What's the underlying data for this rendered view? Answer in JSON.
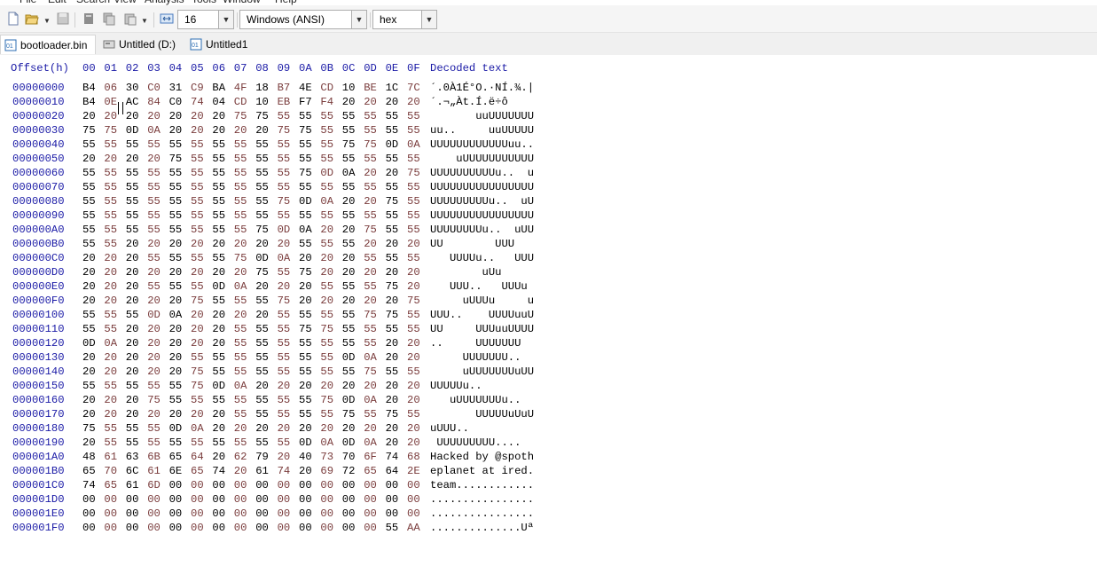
{
  "menu": [
    "File",
    "Edit",
    "Search",
    "View",
    "Analysis",
    "Tools",
    "Window",
    "Help"
  ],
  "toolbar": {
    "bytes_per_row": "16",
    "encoding": "Windows (ANSI)",
    "view_mode": "hex"
  },
  "tabs": [
    {
      "label": "bootloader.bin",
      "active": true
    },
    {
      "label": "Untitled (D:)",
      "active": false
    },
    {
      "label": "Untitled1",
      "active": false
    }
  ],
  "header": {
    "offset": "Offset(h)",
    "columns": [
      "00",
      "01",
      "02",
      "03",
      "04",
      "05",
      "06",
      "07",
      "08",
      "09",
      "0A",
      "0B",
      "0C",
      "0D",
      "0E",
      "0F"
    ],
    "decoded": "Decoded text"
  },
  "rows": [
    {
      "offset": "00000000",
      "bytes": [
        "B4",
        "06",
        "30",
        "C0",
        "31",
        "C9",
        "BA",
        "4F",
        "18",
        "B7",
        "4E",
        "CD",
        "10",
        "BE",
        "1C",
        "7C"
      ],
      "text": "´.0À1É°O.·NÍ.¾.|"
    },
    {
      "offset": "00000010",
      "bytes": [
        "B4",
        "0E",
        "AC",
        "84",
        "C0",
        "74",
        "04",
        "CD",
        "10",
        "EB",
        "F7",
        "F4",
        "20",
        "20",
        "20",
        "20"
      ],
      "text": "´.¬„Àt.Í.ë÷ô    "
    },
    {
      "offset": "00000020",
      "bytes": [
        "20",
        "20",
        "20",
        "20",
        "20",
        "20",
        "20",
        "75",
        "75",
        "55",
        "55",
        "55",
        "55",
        "55",
        "55",
        "55"
      ],
      "text": "       uuUUUUUUU"
    },
    {
      "offset": "00000030",
      "bytes": [
        "75",
        "75",
        "0D",
        "0A",
        "20",
        "20",
        "20",
        "20",
        "20",
        "75",
        "75",
        "55",
        "55",
        "55",
        "55",
        "55"
      ],
      "text": "uu..     uuUUUUU"
    },
    {
      "offset": "00000040",
      "bytes": [
        "55",
        "55",
        "55",
        "55",
        "55",
        "55",
        "55",
        "55",
        "55",
        "55",
        "55",
        "55",
        "75",
        "75",
        "0D",
        "0A"
      ],
      "text": "UUUUUUUUUUUUuu.."
    },
    {
      "offset": "00000050",
      "bytes": [
        "20",
        "20",
        "20",
        "20",
        "75",
        "55",
        "55",
        "55",
        "55",
        "55",
        "55",
        "55",
        "55",
        "55",
        "55",
        "55"
      ],
      "text": "    uUUUUUUUUUUU"
    },
    {
      "offset": "00000060",
      "bytes": [
        "55",
        "55",
        "55",
        "55",
        "55",
        "55",
        "55",
        "55",
        "55",
        "55",
        "75",
        "0D",
        "0A",
        "20",
        "20",
        "75"
      ],
      "text": "UUUUUUUUUUu..  u"
    },
    {
      "offset": "00000070",
      "bytes": [
        "55",
        "55",
        "55",
        "55",
        "55",
        "55",
        "55",
        "55",
        "55",
        "55",
        "55",
        "55",
        "55",
        "55",
        "55",
        "55"
      ],
      "text": "UUUUUUUUUUUUUUUU"
    },
    {
      "offset": "00000080",
      "bytes": [
        "55",
        "55",
        "55",
        "55",
        "55",
        "55",
        "55",
        "55",
        "55",
        "75",
        "0D",
        "0A",
        "20",
        "20",
        "75",
        "55"
      ],
      "text": "UUUUUUUUUu..  uU"
    },
    {
      "offset": "00000090",
      "bytes": [
        "55",
        "55",
        "55",
        "55",
        "55",
        "55",
        "55",
        "55",
        "55",
        "55",
        "55",
        "55",
        "55",
        "55",
        "55",
        "55"
      ],
      "text": "UUUUUUUUUUUUUUUU"
    },
    {
      "offset": "000000A0",
      "bytes": [
        "55",
        "55",
        "55",
        "55",
        "55",
        "55",
        "55",
        "55",
        "75",
        "0D",
        "0A",
        "20",
        "20",
        "75",
        "55",
        "55"
      ],
      "text": "UUUUUUUUu..  uUU"
    },
    {
      "offset": "000000B0",
      "bytes": [
        "55",
        "55",
        "20",
        "20",
        "20",
        "20",
        "20",
        "20",
        "20",
        "20",
        "55",
        "55",
        "55",
        "20",
        "20",
        "20"
      ],
      "text": "UU        UUU   "
    },
    {
      "offset": "000000C0",
      "bytes": [
        "20",
        "20",
        "20",
        "55",
        "55",
        "55",
        "55",
        "75",
        "0D",
        "0A",
        "20",
        "20",
        "20",
        "55",
        "55",
        "55"
      ],
      "text": "   UUUUu..   UUU"
    },
    {
      "offset": "000000D0",
      "bytes": [
        "20",
        "20",
        "20",
        "20",
        "20",
        "20",
        "20",
        "20",
        "75",
        "55",
        "75",
        "20",
        "20",
        "20",
        "20",
        "20"
      ],
      "text": "        uUu     "
    },
    {
      "offset": "000000E0",
      "bytes": [
        "20",
        "20",
        "20",
        "55",
        "55",
        "55",
        "0D",
        "0A",
        "20",
        "20",
        "20",
        "55",
        "55",
        "55",
        "75",
        "20"
      ],
      "text": "   UUU..   UUUu "
    },
    {
      "offset": "000000F0",
      "bytes": [
        "20",
        "20",
        "20",
        "20",
        "20",
        "75",
        "55",
        "55",
        "55",
        "75",
        "20",
        "20",
        "20",
        "20",
        "20",
        "75"
      ],
      "text": "     uUUUu     u"
    },
    {
      "offset": "00000100",
      "bytes": [
        "55",
        "55",
        "55",
        "0D",
        "0A",
        "20",
        "20",
        "20",
        "20",
        "55",
        "55",
        "55",
        "55",
        "75",
        "75",
        "55"
      ],
      "text": "UUU..    UUUUuuU"
    },
    {
      "offset": "00000110",
      "bytes": [
        "55",
        "55",
        "20",
        "20",
        "20",
        "20",
        "20",
        "55",
        "55",
        "55",
        "75",
        "75",
        "55",
        "55",
        "55",
        "55"
      ],
      "text": "UU     UUUuuUUUU"
    },
    {
      "offset": "00000120",
      "bytes": [
        "0D",
        "0A",
        "20",
        "20",
        "20",
        "20",
        "20",
        "55",
        "55",
        "55",
        "55",
        "55",
        "55",
        "55",
        "20",
        "20"
      ],
      "text": "..     UUUUUUU  "
    },
    {
      "offset": "00000130",
      "bytes": [
        "20",
        "20",
        "20",
        "20",
        "20",
        "55",
        "55",
        "55",
        "55",
        "55",
        "55",
        "55",
        "0D",
        "0A",
        "20",
        "20"
      ],
      "text": "     UUUUUUU..  "
    },
    {
      "offset": "00000140",
      "bytes": [
        "20",
        "20",
        "20",
        "20",
        "20",
        "75",
        "55",
        "55",
        "55",
        "55",
        "55",
        "55",
        "55",
        "75",
        "55",
        "55"
      ],
      "text": "     uUUUUUUUuUU"
    },
    {
      "offset": "00000150",
      "bytes": [
        "55",
        "55",
        "55",
        "55",
        "55",
        "75",
        "0D",
        "0A",
        "20",
        "20",
        "20",
        "20",
        "20",
        "20",
        "20",
        "20"
      ],
      "text": "UUUUUu..        "
    },
    {
      "offset": "00000160",
      "bytes": [
        "20",
        "20",
        "20",
        "75",
        "55",
        "55",
        "55",
        "55",
        "55",
        "55",
        "55",
        "75",
        "0D",
        "0A",
        "20",
        "20"
      ],
      "text": "   uUUUUUUUu..  "
    },
    {
      "offset": "00000170",
      "bytes": [
        "20",
        "20",
        "20",
        "20",
        "20",
        "20",
        "20",
        "55",
        "55",
        "55",
        "55",
        "55",
        "75",
        "55",
        "75",
        "55"
      ],
      "text": "       UUUUUuUuU"
    },
    {
      "offset": "00000180",
      "bytes": [
        "75",
        "55",
        "55",
        "55",
        "0D",
        "0A",
        "20",
        "20",
        "20",
        "20",
        "20",
        "20",
        "20",
        "20",
        "20",
        "20"
      ],
      "text": "uUUU..          "
    },
    {
      "offset": "00000190",
      "bytes": [
        "20",
        "55",
        "55",
        "55",
        "55",
        "55",
        "55",
        "55",
        "55",
        "55",
        "0D",
        "0A",
        "0D",
        "0A",
        "20",
        "20"
      ],
      "text": " UUUUUUUUU....  "
    },
    {
      "offset": "000001A0",
      "bytes": [
        "48",
        "61",
        "63",
        "6B",
        "65",
        "64",
        "20",
        "62",
        "79",
        "20",
        "40",
        "73",
        "70",
        "6F",
        "74",
        "68"
      ],
      "text": "Hacked by @spoth"
    },
    {
      "offset": "000001B0",
      "bytes": [
        "65",
        "70",
        "6C",
        "61",
        "6E",
        "65",
        "74",
        "20",
        "61",
        "74",
        "20",
        "69",
        "72",
        "65",
        "64",
        "2E"
      ],
      "text": "eplanet at ired."
    },
    {
      "offset": "000001C0",
      "bytes": [
        "74",
        "65",
        "61",
        "6D",
        "00",
        "00",
        "00",
        "00",
        "00",
        "00",
        "00",
        "00",
        "00",
        "00",
        "00",
        "00"
      ],
      "text": "team............"
    },
    {
      "offset": "000001D0",
      "bytes": [
        "00",
        "00",
        "00",
        "00",
        "00",
        "00",
        "00",
        "00",
        "00",
        "00",
        "00",
        "00",
        "00",
        "00",
        "00",
        "00"
      ],
      "text": "................"
    },
    {
      "offset": "000001E0",
      "bytes": [
        "00",
        "00",
        "00",
        "00",
        "00",
        "00",
        "00",
        "00",
        "00",
        "00",
        "00",
        "00",
        "00",
        "00",
        "00",
        "00"
      ],
      "text": "................"
    },
    {
      "offset": "000001F0",
      "bytes": [
        "00",
        "00",
        "00",
        "00",
        "00",
        "00",
        "00",
        "00",
        "00",
        "00",
        "00",
        "00",
        "00",
        "00",
        "55",
        "AA"
      ],
      "text": "..............Uª"
    }
  ]
}
